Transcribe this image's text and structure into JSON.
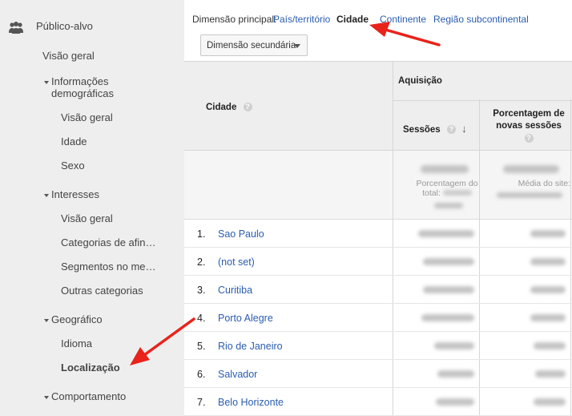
{
  "sidebar": {
    "header": "Público-alvo",
    "items": {
      "visao_geral": "Visão geral",
      "info_demo": "Informações",
      "info_demo2": "demográficas",
      "demo_visao": "Visão geral",
      "idade": "Idade",
      "sexo": "Sexo",
      "interesses": "Interesses",
      "int_visao": "Visão geral",
      "categorias": "Categorias de afin…",
      "segmentos": "Segmentos no me…",
      "outras": "Outras categorias",
      "geografico": "Geográfico",
      "idioma": "Idioma",
      "localizacao": "Localização",
      "comportamento": "Comportamento"
    }
  },
  "topbar": {
    "label": "Dimensão principal:",
    "pais": "País/território",
    "cidade": "Cidade",
    "continente": "Continente",
    "regiao": "Região subcontinental"
  },
  "secondary_dim": "Dimensão secundária",
  "table": {
    "col_cidade": "Cidade",
    "group_aquisicao": "Aquisição",
    "col_sessoes": "Sessões",
    "col_pct1": "Porcentagem de",
    "col_pct2": "novas sessões",
    "total_sub1a": "Porcentagem do",
    "total_sub1b": "total:",
    "total_sub2": "Média do site:",
    "rows": [
      {
        "num": "1.",
        "city": "Sao Paulo"
      },
      {
        "num": "2.",
        "city": "(not set)"
      },
      {
        "num": "3.",
        "city": "Curitiba"
      },
      {
        "num": "4.",
        "city": "Porto Alegre"
      },
      {
        "num": "5.",
        "city": "Rio de Janeiro"
      },
      {
        "num": "6.",
        "city": "Salvador"
      },
      {
        "num": "7.",
        "city": "Belo Horizonte"
      }
    ]
  },
  "colors": {
    "link": "#2a5db0",
    "annotation_arrow": "#e8231b",
    "sidebar_bg": "#eeeeee"
  }
}
